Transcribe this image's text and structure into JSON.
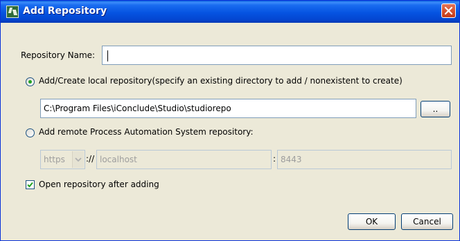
{
  "window": {
    "title": "Add Repository"
  },
  "form": {
    "repo_name_label": "Repository Name:",
    "repo_name_value": "",
    "local_option_label": "Add/Create local repository(specify an existing directory to add / nonexistent to create)",
    "local_path_value": "C:\\Program Files\\iConclude\\Studio\\studiorepo",
    "browse_label": "..",
    "remote_option_label": "Add remote Process Automation System repository:",
    "protocol_value": "https",
    "separator": "://",
    "host_value": "localhost",
    "port_separator": ":",
    "port_value": "8443",
    "open_after_label": "Open repository after adding",
    "open_after_checked": true,
    "selected_option": "local"
  },
  "buttons": {
    "ok": "OK",
    "cancel": "Cancel"
  }
}
